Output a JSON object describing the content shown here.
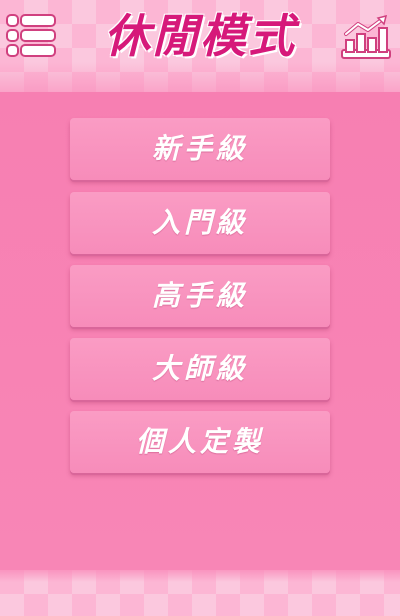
{
  "header": {
    "title": "休閒模式",
    "menu_icon": "menu-list-icon",
    "stats_icon": "bar-chart-trend-icon"
  },
  "levels": [
    {
      "label": "新手級"
    },
    {
      "label": "入門級"
    },
    {
      "label": "高手級"
    },
    {
      "label": "大師級"
    },
    {
      "label": "個人定製"
    }
  ],
  "colors": {
    "background": "#f98cba",
    "title": "#d6197a",
    "button": "#fa9cc4",
    "checker_light": "#fbc8de",
    "checker_base": "#fcb6d4"
  }
}
